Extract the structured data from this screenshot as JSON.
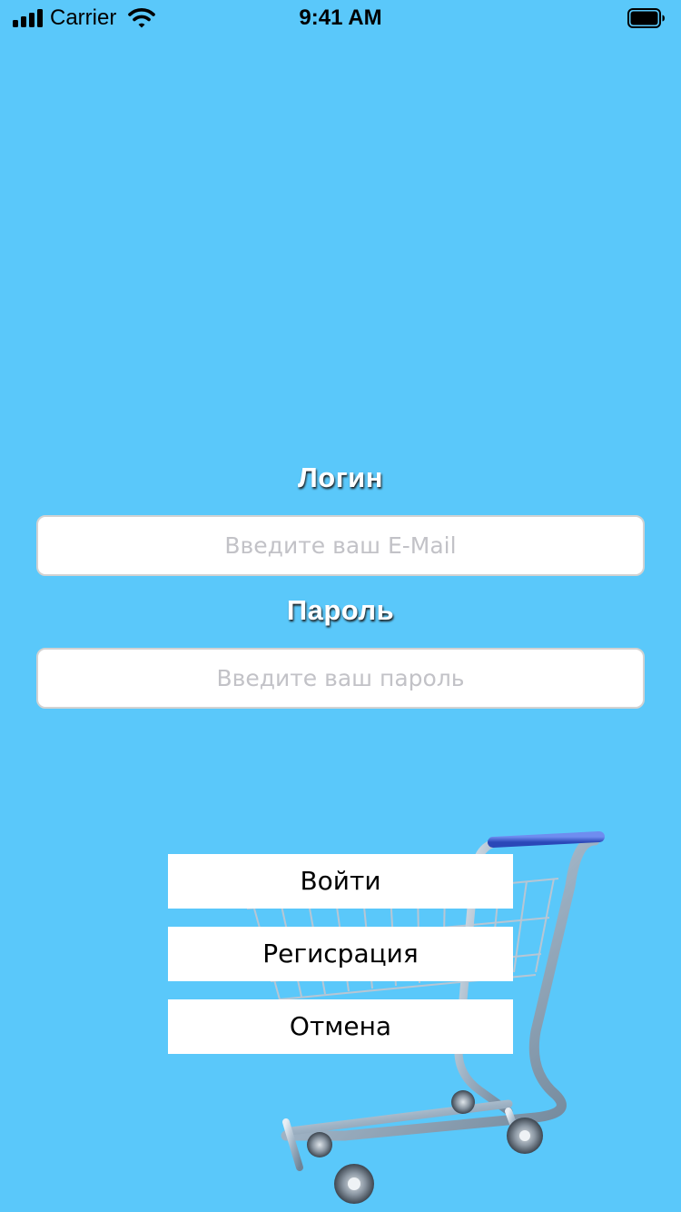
{
  "status_bar": {
    "carrier": "Carrier",
    "time": "9:41 AM",
    "icons": [
      "signal-icon",
      "wifi-icon",
      "battery-icon"
    ]
  },
  "login": {
    "label": "Логин",
    "placeholder": "Введите ваш E-Mail",
    "value": ""
  },
  "password": {
    "label": "Пароль",
    "placeholder": "Введите ваш пароль",
    "value": ""
  },
  "buttons": {
    "login": "Войти",
    "register": "Регисрация",
    "cancel": "Отмена"
  },
  "illustration": "shopping-cart-image",
  "colors": {
    "background": "#5AC8FA",
    "field_background": "#FFFFFF",
    "placeholder": "#C2C2C7",
    "label_text": "#FFFFFF",
    "button_background": "#FFFFFF",
    "cart_handle": "#3A5FD6"
  }
}
